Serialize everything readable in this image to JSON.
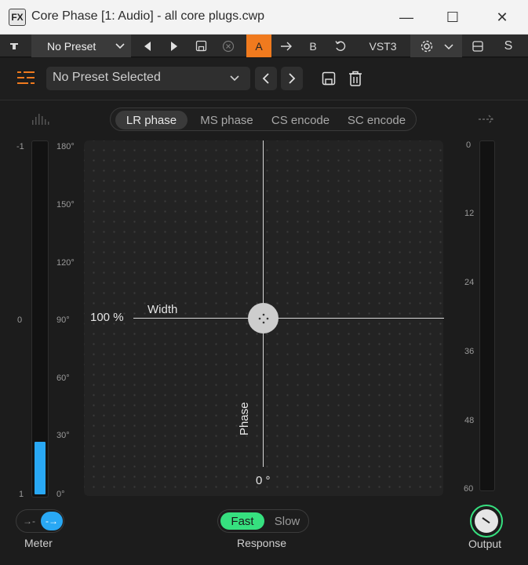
{
  "window": {
    "badge": "FX",
    "title": "Core Phase [1: Audio] - all core plugs.cwp",
    "minimize": "—",
    "maximize": "☐",
    "close": "✕"
  },
  "host_toolbar": {
    "preset": "No Preset",
    "a_label": "A",
    "b_label": "B",
    "format": "VST3",
    "s_label": "S",
    "accent_color": "#f07a1e"
  },
  "plugin_header": {
    "preset_selected": "No Preset Selected"
  },
  "tabs": [
    "LR phase",
    "MS phase",
    "CS encode",
    "SC encode"
  ],
  "active_tab": "LR phase",
  "left_meter": {
    "labels": [
      "-1",
      "0",
      "1"
    ],
    "fill_fraction": 0.15,
    "fill_color": "#29a8f4"
  },
  "phase_scale": [
    "180°",
    "150°",
    "120°",
    "90°",
    "60°",
    "30°",
    "0°"
  ],
  "right_meter": {
    "labels": [
      "0",
      "12",
      "24",
      "36",
      "48",
      "60"
    ]
  },
  "plot": {
    "width_value": "100 %",
    "width_label": "Width",
    "phase_label": "Phase",
    "phase_value": "0 °"
  },
  "meter_toggle": {
    "label": "Meter",
    "left_glyph": "→-",
    "right_glyph": "-→"
  },
  "response": {
    "label": "Response",
    "options": [
      "Fast",
      "Slow"
    ],
    "selected": "Fast",
    "active_color": "#36e07f"
  },
  "output": {
    "label": "Output"
  }
}
